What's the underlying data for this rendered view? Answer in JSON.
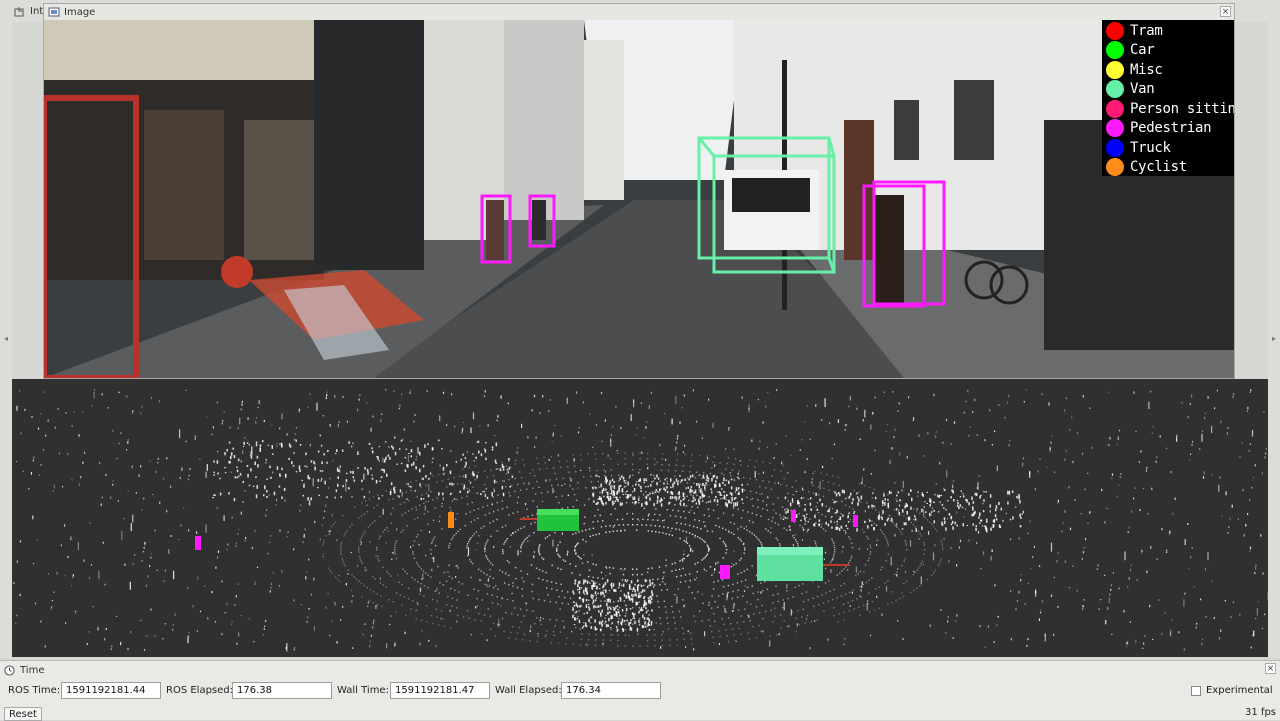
{
  "tabs": [
    {
      "label": "Inter",
      "icon": "interact-icon"
    },
    {
      "label": "Image",
      "icon": "image-icon"
    }
  ],
  "image_panel": {
    "title": "Image",
    "close_glyph": "×"
  },
  "legend": [
    {
      "label": "Tram",
      "color": "#ff0000"
    },
    {
      "label": "Car",
      "color": "#00ff00"
    },
    {
      "label": "Misc",
      "color": "#ffff33"
    },
    {
      "label": "Van",
      "color": "#66f0a8"
    },
    {
      "label": "Person sitting",
      "color": "#ff1a75"
    },
    {
      "label": "Pedestrian",
      "color": "#ff19ff"
    },
    {
      "label": "Truck",
      "color": "#0000ff"
    },
    {
      "label": "Cyclist",
      "color": "#ff8c1a"
    }
  ],
  "time_panel": {
    "title": "Time",
    "close_glyph": "×",
    "ros_time_label": "ROS Time:",
    "ros_time": "1591192181.44",
    "ros_elapsed_label": "ROS Elapsed:",
    "ros_elapsed": "176.38",
    "wall_time_label": "Wall Time:",
    "wall_time": "1591192181.47",
    "wall_elapsed_label": "Wall Elapsed:",
    "wall_elapsed": "176.34",
    "experimental_label": "Experimental",
    "reset_label": "Reset",
    "fps": "31 fps"
  }
}
